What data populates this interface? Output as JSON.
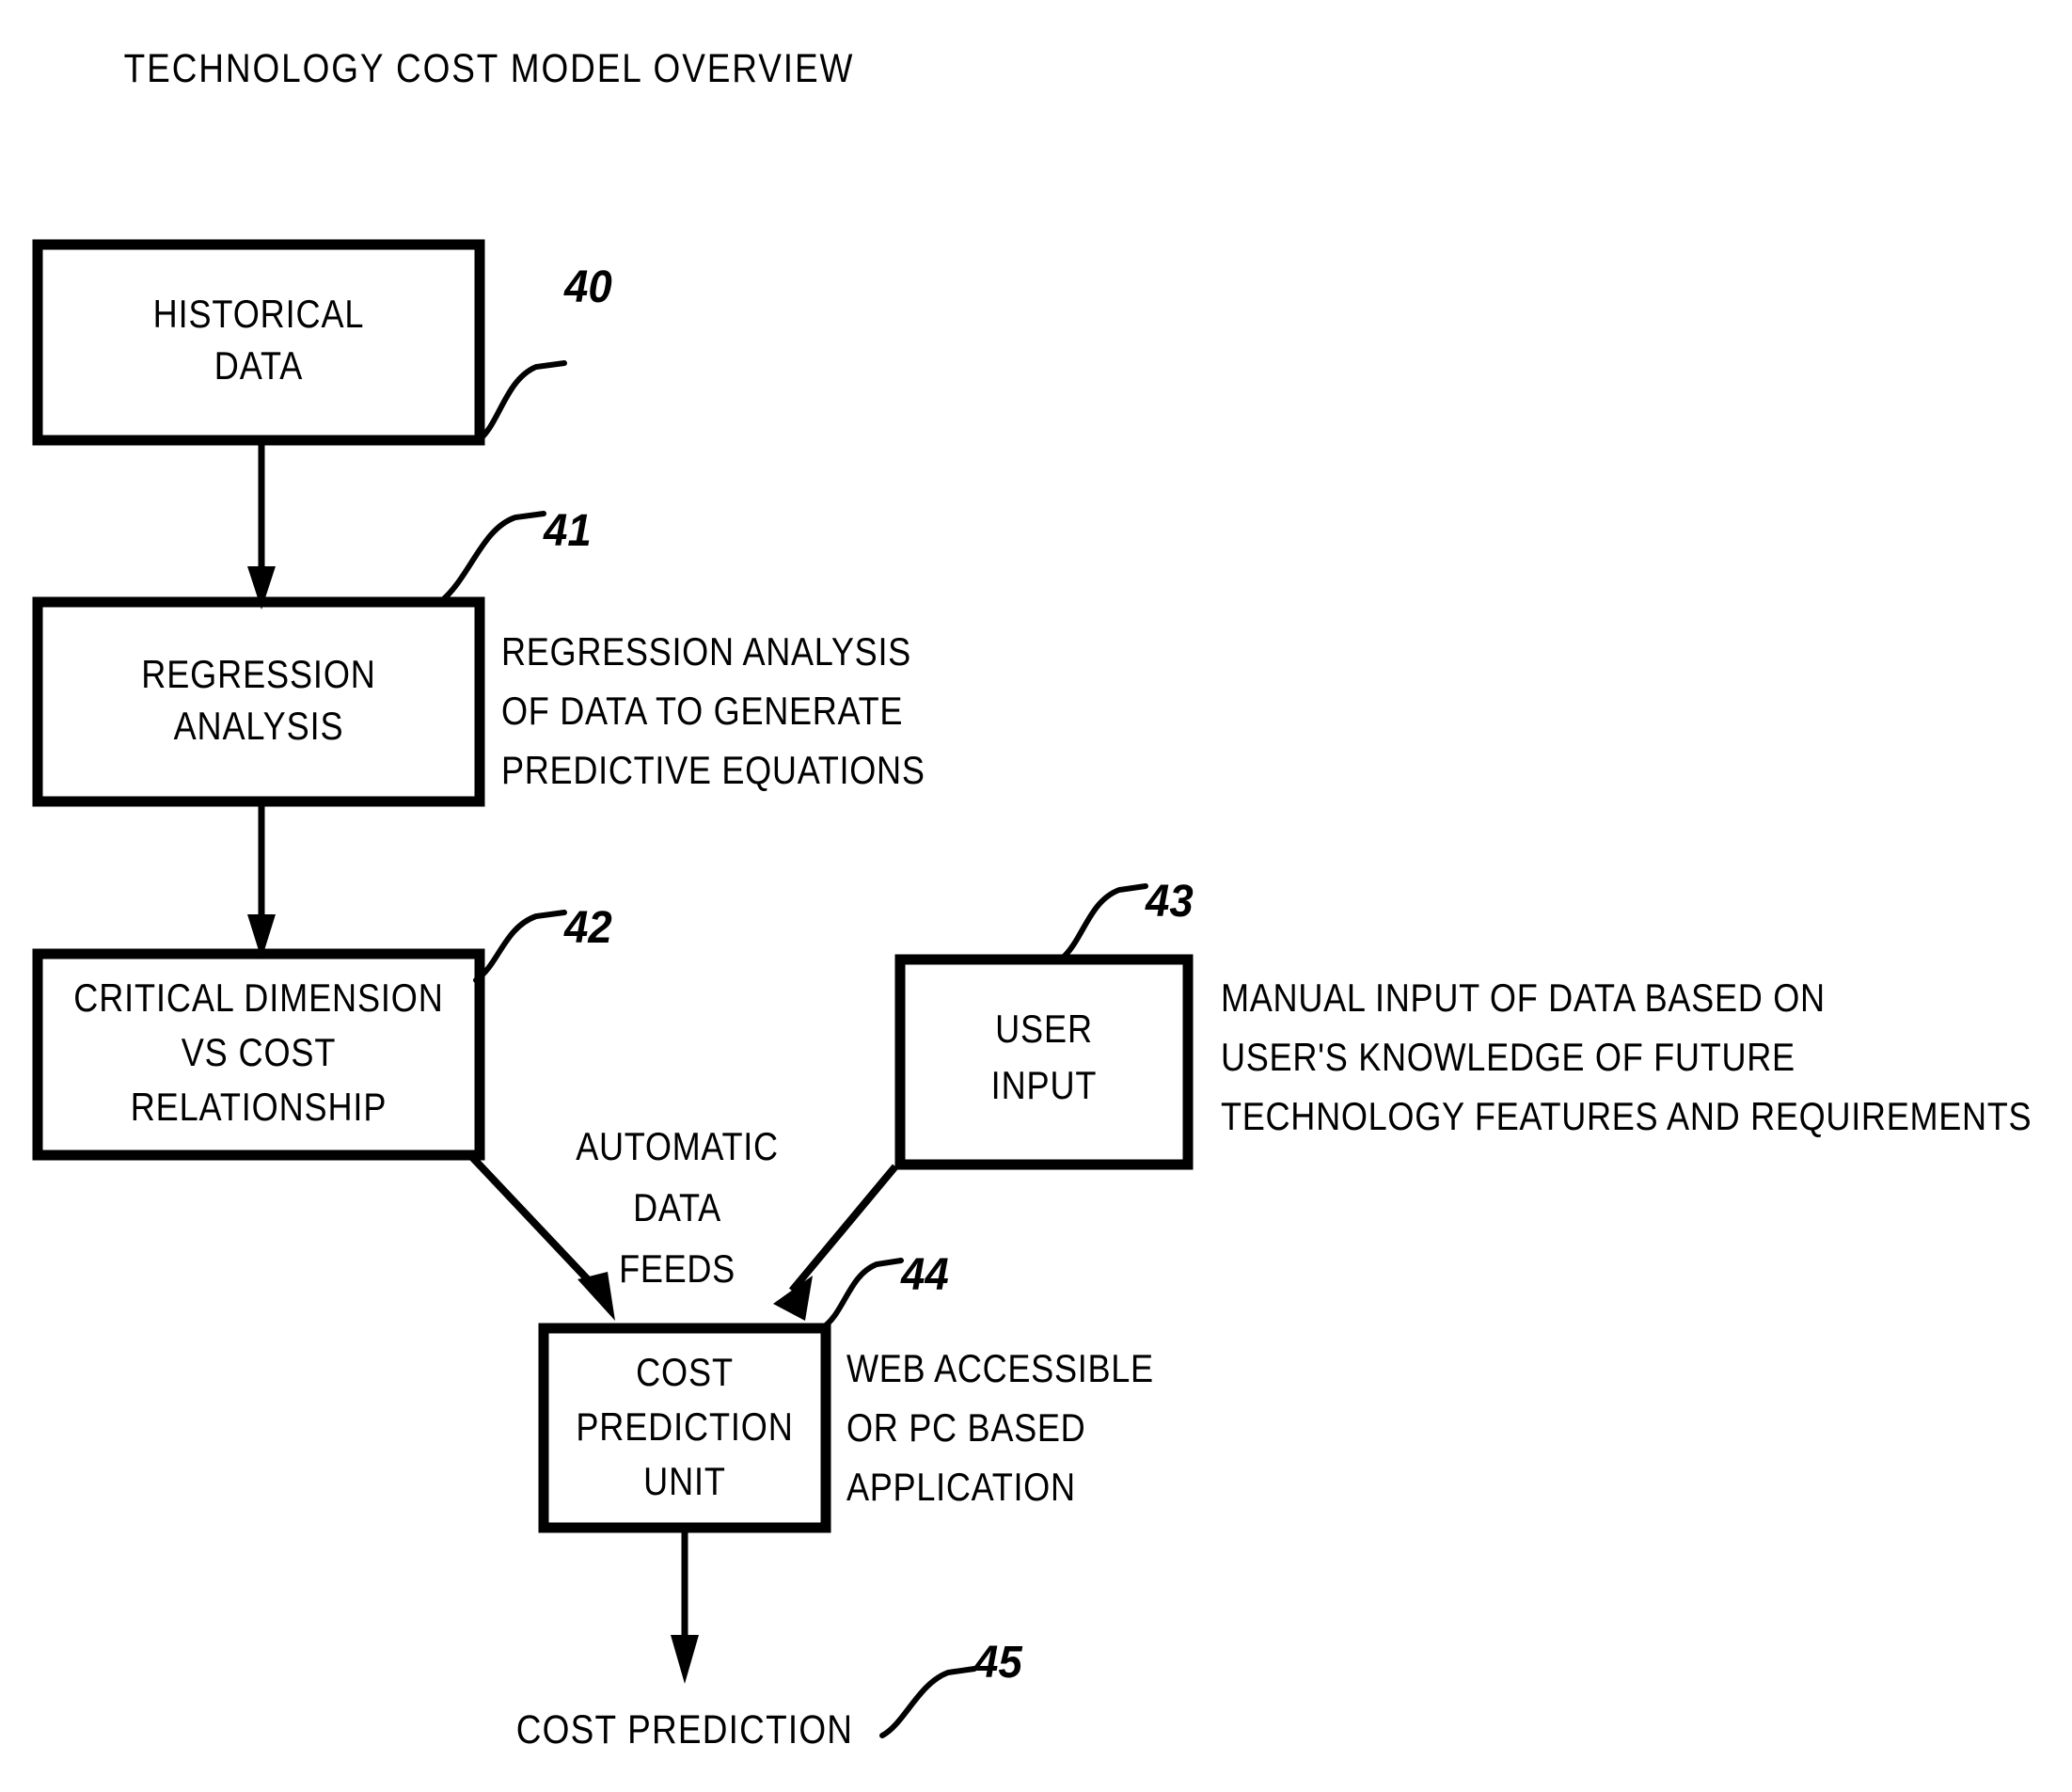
{
  "title": "TECHNOLOGY COST MODEL OVERVIEW",
  "boxes": [
    {
      "id": "historical-data",
      "lines": [
        "HISTORICAL",
        "DATA"
      ],
      "ref": "40"
    },
    {
      "id": "regression-analysis",
      "lines": [
        "REGRESSION",
        "ANALYSIS"
      ],
      "ref": "41"
    },
    {
      "id": "critical-dimension",
      "lines": [
        "CRITICAL DIMENSION",
        "VS COST",
        "RELATIONSHIP"
      ],
      "ref": "42"
    },
    {
      "id": "user-input",
      "lines": [
        "USER",
        "INPUT"
      ],
      "ref": "43"
    },
    {
      "id": "cost-prediction-unit",
      "lines": [
        "COST",
        "PREDICTION",
        "UNIT"
      ],
      "ref": "44"
    }
  ],
  "annotations": {
    "regression": [
      "REGRESSION ANALYSIS",
      "OF DATA TO GENERATE",
      "PREDICTIVE EQUATIONS"
    ],
    "user_input": [
      "MANUAL INPUT OF DATA BASED ON",
      "USER'S KNOWLEDGE OF FUTURE",
      "TECHNOLOGY FEATURES AND REQUIREMENTS"
    ],
    "cost_prediction_unit": [
      "WEB ACCESSIBLE",
      "OR PC BASED",
      "APPLICATION"
    ]
  },
  "flow_note": [
    "AUTOMATIC",
    "DATA",
    "FEEDS"
  ],
  "output": {
    "label": "COST PREDICTION",
    "ref": "45"
  },
  "ref_numbers": {
    "historical_data": "40",
    "regression_analysis": "41",
    "critical_dimension": "42",
    "user_input": "43",
    "cost_prediction_unit": "44",
    "cost_prediction_output": "45"
  },
  "colors": {
    "ink": "#000000",
    "paper": "#ffffff"
  }
}
